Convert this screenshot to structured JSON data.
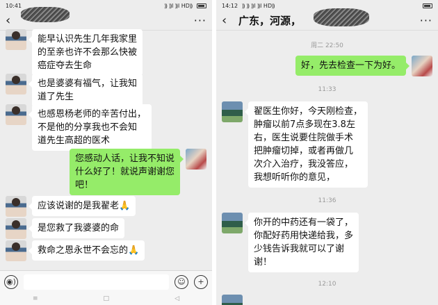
{
  "left": {
    "status": {
      "time": "10:41",
      "signal": "⸩ ⸩l ⸩l HD⸩"
    },
    "title": "",
    "messages": [
      {
        "side": "recv",
        "text": "能早认识先生几年我家里\n的至亲也许不会那么快被\n癌症夺去生命"
      },
      {
        "side": "recv",
        "text": "也是婆婆有福气，让我知\n道了先生"
      },
      {
        "side": "recv",
        "text": "也感恩杨老师的辛苦付出，\n不是他的分享我也不会知\n道先生高超的医术"
      },
      {
        "side": "sent",
        "text": "您感动人话，让我不知说\n什么好了！就说声谢谢您\n吧！"
      },
      {
        "side": "recv",
        "text": "应该说谢的是我翟老🙏"
      },
      {
        "side": "recv",
        "text": "是您救了我婆婆的命"
      },
      {
        "side": "recv",
        "text": "救命之恩永世不会忘的🙏"
      }
    ],
    "input": {
      "voice_icon": "◉)",
      "emoji_icon": "☺",
      "plus_icon": "+"
    },
    "nav": [
      "≡",
      "□",
      "◁"
    ]
  },
  "right": {
    "status": {
      "time": "14:12",
      "signal": "⸩ ⸩ ⸩l ⸩l HD⸩"
    },
    "title": "广东，河源，",
    "items": [
      {
        "kind": "time",
        "text": "周二 22:50"
      },
      {
        "kind": "sent",
        "text": "好，先去检查一下为好。"
      },
      {
        "kind": "time",
        "text": "11:33"
      },
      {
        "kind": "recv",
        "text": "翟医生你好，今天刚检查，\n肿瘤以前7点多现在3.8左\n右，医生说要住院做手术\n把肿瘤切掉，或者再做几\n次介入治疗，我没答应，\n我想听听你的意见，"
      },
      {
        "kind": "time",
        "text": "11:36"
      },
      {
        "kind": "recv",
        "text": "你开的中药还有一袋了，\n你配好药用快递给我，多\n少钱告诉我就可以了谢\n谢！"
      },
      {
        "kind": "time",
        "text": "12:10"
      }
    ]
  }
}
